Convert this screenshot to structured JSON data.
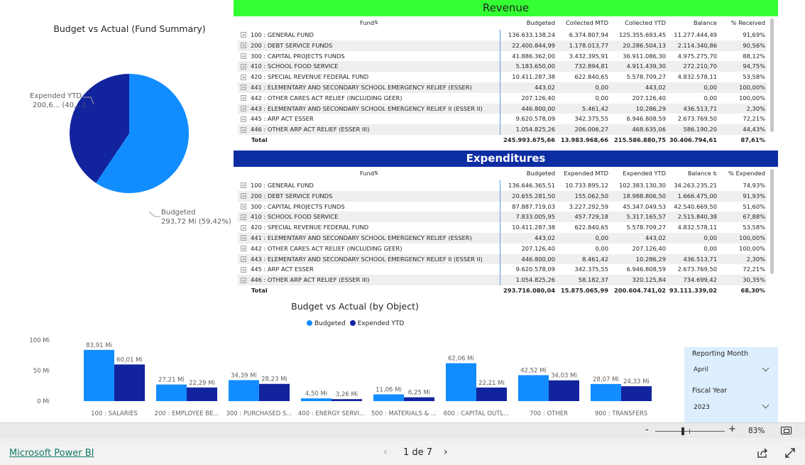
{
  "pie": {
    "title": "Budget vs Actual (Fund Summary)",
    "label_expended_1": "Expended YTD",
    "label_expended_2": "200,6... (40,...)",
    "label_budgeted_1": "Budgeted",
    "label_budgeted_2": "293,72 Mi (59,42%)",
    "colors": {
      "budgeted": "#118dff",
      "expended": "#12239e"
    }
  },
  "revenue": {
    "title": "Revenue",
    "columns": [
      "Fund",
      "Budgeted",
      "Collected MTD",
      "Collected YTD",
      "Balance",
      "% Received"
    ],
    "rows": [
      [
        "100 : GENERAL FUND",
        "136.633.138,24",
        "6.374.807,94",
        "125.355.693,45",
        "11.277.444,49",
        "91,69%"
      ],
      [
        "200 : DEBT SERVICE FUNDS",
        "22.400.844,99",
        "1.178.013,77",
        "20.286.504,13",
        "2.114.340,86",
        "90,56%"
      ],
      [
        "300 : CAPITAL PROJECTS FUNDS",
        "41.886.362,00",
        "3.432.395,91",
        "36.911.086,30",
        "4.975.275,70",
        "88,12%"
      ],
      [
        "410 : SCHOOL FOOD SERVICE",
        "5.183.650,00",
        "732.894,81",
        "4.911.439,30",
        "272.210,70",
        "94,75%"
      ],
      [
        "420 : SPECIAL REVENUE FEDERAL FUND",
        "10.411.287,38",
        "622.840,65",
        "5.578.709,27",
        "4.832.578,11",
        "53,58%"
      ],
      [
        "441 : ELEMENTARY AND SECONDARY SCHOOL EMERGENCY RELIEF (ESSER)",
        "443,02",
        "0,00",
        "443,02",
        "0,00",
        "100,00%"
      ],
      [
        "442 : OTHER CARES ACT RELIEF (INCLUDING GEER)",
        "207.126,40",
        "0,00",
        "207.126,40",
        "0,00",
        "100,00%"
      ],
      [
        "443 : ELEMENTARY AND SECONDARY SCHOOL EMERGENCY RELIEF II (ESSER II)",
        "446.800,00",
        "5.461,42",
        "10.286,29",
        "436.513,71",
        "2,30%"
      ],
      [
        "445 : ARP ACT ESSER",
        "9.620.578,09",
        "342.375,55",
        "6.946.808,59",
        "2.673.769,50",
        "72,21%"
      ],
      [
        "446 : OTHER ARP ACT RELIEF (ESSER III)",
        "1.054.825,26",
        "206.006,27",
        "468.635,06",
        "586.190,20",
        "44,43%"
      ]
    ],
    "total": [
      "Total",
      "245.993.675,66",
      "13.983.968,66",
      "215.586.880,75",
      "30.406.794,61",
      "87,61%"
    ]
  },
  "expenditures": {
    "title": "Expenditures",
    "columns": [
      "Fund",
      "Budgeted",
      "Expended MTD",
      "Expended YTD",
      "Balance",
      "% Expended"
    ],
    "rows": [
      [
        "100 : GENERAL FUND",
        "136.646.365,51",
        "10.733.895,12",
        "102.383.130,30",
        "34.263.235,21",
        "74,93%"
      ],
      [
        "200 : DEBT SERVICE FUNDS",
        "20.655.281,50",
        "155.062,50",
        "18.988.806,50",
        "1.666.475,00",
        "91,93%"
      ],
      [
        "300 : CAPITAL PROJECTS FUNDS",
        "87.887.719,03",
        "3.227.292,59",
        "45.347.049,53",
        "42.540.669,50",
        "51,60%"
      ],
      [
        "410 : SCHOOL FOOD SERVICE",
        "7.833.005,95",
        "457.729,18",
        "5.317.165,57",
        "2.515.840,38",
        "67,88%"
      ],
      [
        "420 : SPECIAL REVENUE FEDERAL FUND",
        "10.411.287,38",
        "622.840,65",
        "5.578.709,27",
        "4.832.578,11",
        "53,58%"
      ],
      [
        "441 : ELEMENTARY AND SECONDARY SCHOOL EMERGENCY RELIEF (ESSER)",
        "443,02",
        "0,00",
        "443,02",
        "0,00",
        "100,00%"
      ],
      [
        "442 : OTHER CARES ACT RELIEF (INCLUDING GEER)",
        "207.126,40",
        "0,00",
        "207.126,40",
        "0,00",
        "100,00%"
      ],
      [
        "443 : ELEMENTARY AND SECONDARY SCHOOL EMERGENCY RELIEF II (ESSER II)",
        "446.800,00",
        "8.461,42",
        "10.286,29",
        "436.513,71",
        "2,30%"
      ],
      [
        "445 : ARP ACT ESSER",
        "9.620.578,09",
        "342.375,55",
        "6.946.808,59",
        "2.673.769,50",
        "72,21%"
      ],
      [
        "446 : OTHER ARP ACT RELIEF (ESSER III)",
        "1.054.825,26",
        "58.182,37",
        "320.125,84",
        "734.699,42",
        "30,35%"
      ]
    ],
    "total": [
      "Total",
      "293.716.080,04",
      "15.875.065,99",
      "200.604.741,02",
      "93.111.339,02",
      "68,30%"
    ]
  },
  "bar": {
    "title": "Budget vs Actual (by Object)",
    "legend_budgeted": "Budgeted",
    "legend_expended": "Expended YTD",
    "y_ticks": [
      "0 Mi",
      "50 Mi",
      "100 Mi"
    ]
  },
  "chart_data": {
    "type": "bar",
    "categories": [
      "100 : SALARIES",
      "200 : EMPLOYEE BE...",
      "300 : PURCHASED S...",
      "400 : ENERGY SERVI...",
      "500 : MATERIALS & ...",
      "600 : CAPITAL OUTL...",
      "700 : OTHER",
      "900 : TRANSFERS"
    ],
    "series": [
      {
        "name": "Budgeted",
        "values": [
          83.91,
          27.21,
          34.39,
          4.5,
          11.06,
          62.06,
          42.52,
          28.07
        ],
        "labels": [
          "83,91 Mi",
          "27,21 Mi",
          "34,39 Mi",
          "4,50 Mi",
          "11,06 Mi",
          "62,06 Mi",
          "42,52 Mi",
          "28,07 Mi"
        ],
        "color": "#118dff"
      },
      {
        "name": "Expended YTD",
        "values": [
          60.01,
          22.29,
          28.23,
          3.26,
          6.25,
          22.21,
          34.03,
          24.33
        ],
        "labels": [
          "60,01 Mi",
          "22,29 Mi",
          "28,23 Mi",
          "3,26 Mi",
          "6,25 Mi",
          "22,21 Mi",
          "34,03 Mi",
          "24,33 Mi"
        ],
        "color": "#12239e"
      }
    ],
    "ylim": [
      0,
      100
    ],
    "legend": "top"
  },
  "slicers": {
    "reporting_month_label": "Reporting Month",
    "reporting_month_value": "April",
    "fiscal_year_label": "Fiscal Year",
    "fiscal_year_value": "2023"
  },
  "zoom": {
    "minus": "-",
    "plus": "+",
    "percent": "83%"
  },
  "footer": {
    "brand": "Microsoft Power BI",
    "page": "1 de 7",
    "prev": "‹",
    "next": "›"
  }
}
